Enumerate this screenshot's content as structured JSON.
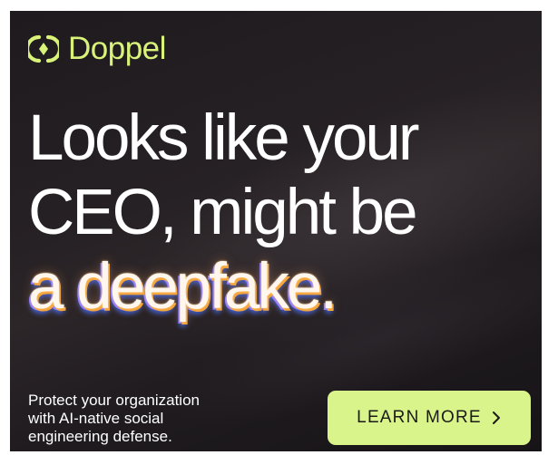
{
  "brand": {
    "name": "Doppel",
    "color": "#d8f27a",
    "icon": "doppel-logo-icon"
  },
  "headline": {
    "line1": "Looks like your",
    "line2": "CEO, might be",
    "line3": "a deepfake."
  },
  "subtext": {
    "line1": "Protect your organization",
    "line2": "with AI-native social",
    "line3": "engineering defense."
  },
  "cta": {
    "label": "LEARN MORE",
    "icon": "chevron-right-icon",
    "color": "#d9f48b"
  },
  "colors": {
    "background": "#211d21",
    "text": "#ffffff"
  }
}
